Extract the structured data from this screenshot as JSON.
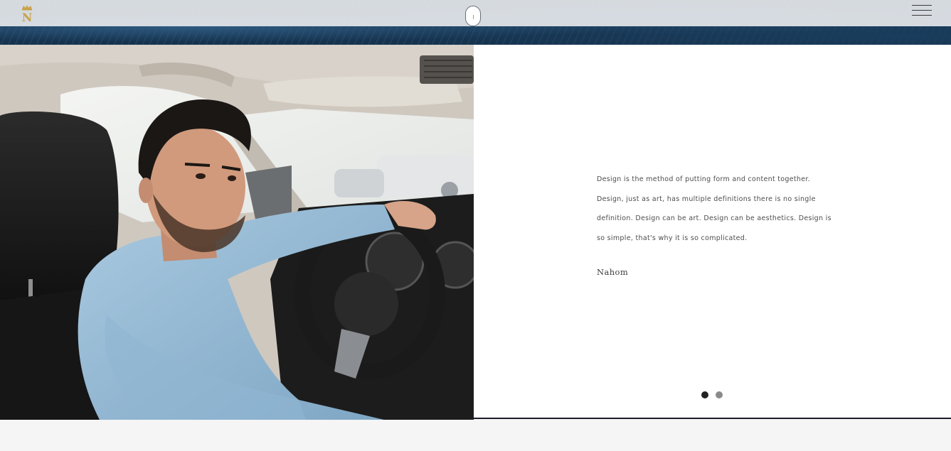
{
  "header": {
    "logo_letter": "N",
    "logo_icon": "crown-icon",
    "scroll_indicator_icon": "mouse-scroll-icon",
    "menu_icon": "hamburger-menu-icon"
  },
  "slide": {
    "photo_icon": "man-driving-car-photo",
    "quote": "Design is the method of putting form and content together. Design, just as art, has multiple definitions there is no single definition. Design can be art. Design can be aesthetics. Design is so simple, that's why it is so complicated.",
    "author": "Nahom",
    "dots": [
      {
        "active": true
      },
      {
        "active": false
      }
    ]
  },
  "colors": {
    "header_bar": "#15334f",
    "accent_gold": "#c8a24a",
    "dot_active": "#222222",
    "dot_inactive": "#8a8a8a",
    "panel_rule": "#1d1a2c"
  }
}
